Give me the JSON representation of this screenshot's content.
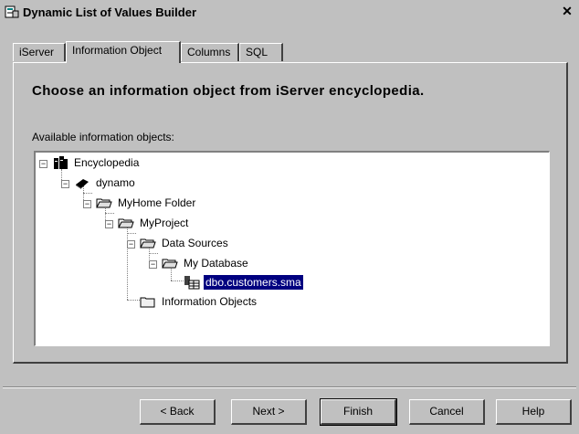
{
  "window": {
    "title": "Dynamic List of Values Builder",
    "close_glyph": "✕"
  },
  "tabs": [
    {
      "label": "iServer"
    },
    {
      "label": "Information Object"
    },
    {
      "label": "Columns"
    },
    {
      "label": "SQL"
    }
  ],
  "panel": {
    "heading": "Choose an information object from iServer encyclopedia.",
    "available_label": "Available information objects:"
  },
  "tree": {
    "nodes": [
      {
        "label": "Encyclopedia",
        "icon": "encyclopedia-icon",
        "expanded": true
      },
      {
        "label": "dynamo",
        "icon": "server-icon",
        "expanded": true
      },
      {
        "label": "MyHome Folder",
        "icon": "folder-icon",
        "expanded": true
      },
      {
        "label": "MyProject",
        "icon": "folder-icon",
        "expanded": true
      },
      {
        "label": "Data Sources",
        "icon": "folder-icon",
        "expanded": true
      },
      {
        "label": "My Database",
        "icon": "folder-icon",
        "expanded": true
      },
      {
        "label": "dbo.customers.sma",
        "icon": "table-icon",
        "selected": true
      },
      {
        "label": "Information Objects",
        "icon": "folder-icon"
      }
    ]
  },
  "buttons": {
    "back": "< Back",
    "next": "Next >",
    "finish": "Finish",
    "cancel": "Cancel",
    "help": "Help"
  },
  "colors": {
    "selection": "#000080",
    "face": "#c0c0c0"
  }
}
